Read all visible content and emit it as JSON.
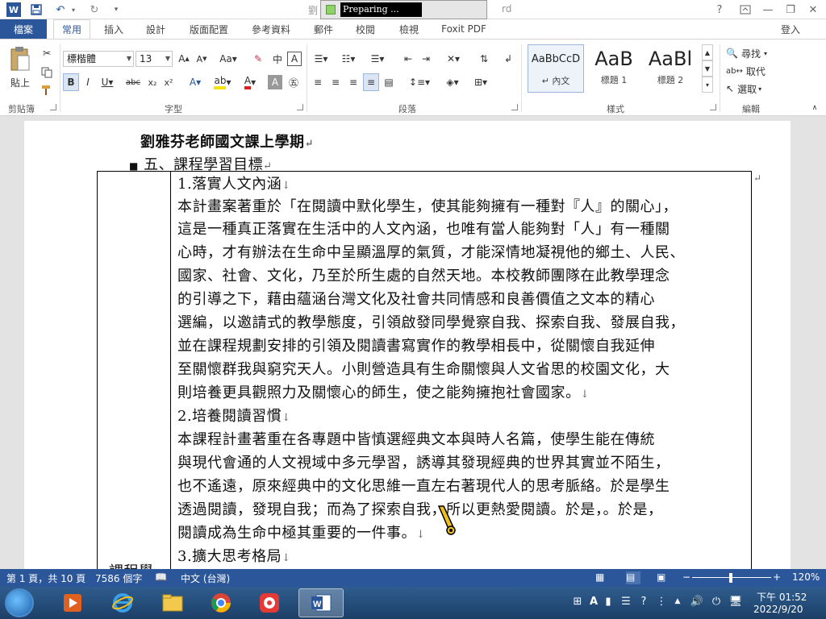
{
  "titlebar": {
    "app_icon": "W",
    "doc_title": "劉",
    "doc_title_tail": "rd",
    "progress_label": "Preparing ...",
    "help": "?",
    "minimize": "—",
    "restore": "❐",
    "close": "✕"
  },
  "ribbon_tabs": {
    "file": "檔案",
    "tabs": [
      "常用",
      "插入",
      "設計",
      "版面配置",
      "參考資料",
      "郵件",
      "校閱",
      "檢視",
      "Foxit PDF"
    ],
    "signin": "登入"
  },
  "ribbon": {
    "clipboard": {
      "paste": "貼上",
      "label": "剪貼簿"
    },
    "font": {
      "family": "標楷體",
      "size": "13",
      "label": "字型"
    },
    "paragraph": {
      "label": "段落"
    },
    "styles": {
      "label": "樣式",
      "items": [
        {
          "sample": "AaBbCcD",
          "name": "↵ 內文"
        },
        {
          "sample": "AaB",
          "name": "標題 1"
        },
        {
          "sample": "AaBl",
          "name": "標題 2"
        }
      ]
    },
    "editing": {
      "find": "尋找",
      "replace": "取代",
      "select": "選取",
      "label": "編輯"
    }
  },
  "document": {
    "title": "劉雅芬老師國文課上學期",
    "section": "五、課程學習目標",
    "row_label": "課程學",
    "lines": [
      "1.落實人文內涵",
      "本計畫案著重於「在閱讀中默化學生，使其能夠擁有一種對『人』的關心」，",
      "這是一種真正落實在生活中的人文內涵，也唯有當人能夠對「人」有一種關",
      "心時，才有辦法在生命中呈顯溫厚的氣質，才能深情地凝視他的鄉土、人民、",
      "國家、社會、文化，乃至於所生處的自然天地。本校教師團隊在此教學理念",
      "的引導之下，藉由蘊涵台灣文化及社會共同情感和良善價值之文本的精心",
      "選編，以邀請式的教學態度，引領啟發同學覺察自我、探索自我、發展自我，",
      "並在課程規劃安排的引領及閱讀書寫實作的教學相長中，從關懷自我延伸",
      "至關懷群我與窮究天人。小則營造具有生命關懷與人文省思的校園文化，大",
      "則培養更具觀照力及關懷心的師生，使之能夠擁抱社會國家。",
      "2.培養閱讀習慣",
      "本課程計畫著重在各專題中皆慎選經典文本與時人名篇，使學生能在傳統",
      "與現代會通的人文視域中多元學習，誘導其發現經典的世界其實並不陌生，",
      "也不遙遠，原來經典中的文化思維一直左右著現代人的思考脈絡。於是學生",
      "透過閱讀，發現自我；而為了探索自我，所以更熱愛閱讀。於是，。於是，",
      "閱讀成為生命中極其重要的一件事。",
      "3.擴大思考格局"
    ]
  },
  "statusbar": {
    "page": "第 1 頁，共 10 頁",
    "words": "7586 個字",
    "language": "中文 (台灣)",
    "zoom": "120%"
  },
  "taskbar": {
    "time": "下午 01:52",
    "date": "2022/9/20"
  },
  "colors": {
    "accent": "#2b579a",
    "proofing_blue": "#3b6ee8",
    "proofing_red": "#e03030"
  }
}
